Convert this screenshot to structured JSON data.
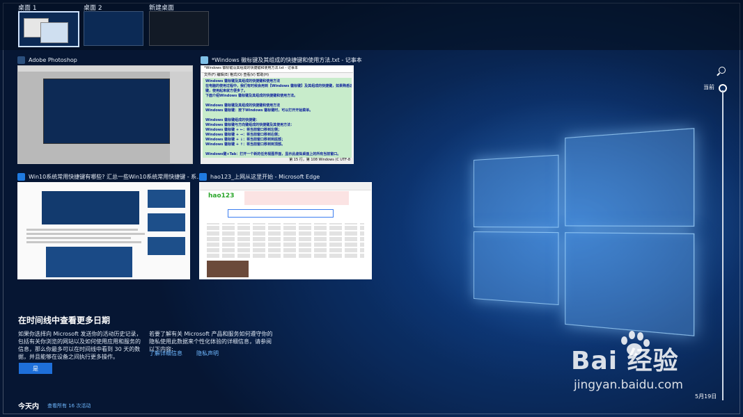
{
  "desktops": {
    "items": [
      {
        "label": "桌面 1"
      },
      {
        "label": "桌面 2"
      },
      {
        "label": "新建桌面"
      }
    ]
  },
  "windows": [
    {
      "title": "Adobe Photoshop",
      "icon": "photoshop-icon"
    },
    {
      "title": "*Windows 徽标键及其组成的快捷键和使用方法.txt - 记事本",
      "icon": "notepad-icon"
    },
    {
      "title": "Win10系统常用快捷键有哪些? 汇总一些Win10系统常用快捷键 - 系...",
      "icon": "edge-icon"
    },
    {
      "title": "hao123_上网从这里开始 - Microsoft Edge",
      "icon": "edge-icon"
    }
  ],
  "notepad": {
    "window_title": "*Windows 徽标键及其组成的快捷键和使用方法.txt - 记事本",
    "menu": "文件(F)  编辑(E)  格式(O)  查看(V)  帮助(H)",
    "lines": [
      "Windows 徽标键及其组成的快捷键和使用方法",
      "在电脑的使用过程中，我们有时候会用到【Windows 徽标键】及其组成的快捷键，如果熟悉这些快捷",
      "键，使用起来就方便多了。",
      "下面介绍Windows 徽标键及其组成的快捷键和使用方法。",
      "",
      "Windows 徽标键及其组成的快捷键和使用方法",
      "Windows 徽标键：按下Windows 徽标键时，可以打开开始菜单。",
      "",
      "Windows 徽标键组成的快捷键：",
      "Windows 徽标键与方向键组成的快捷键及其使用方法：",
      "Windows 徽标键 + ←：将当前窗口移到左侧；",
      "Windows 徽标键 + →：将当前窗口移到右侧；",
      "Windows 徽标键 + ↓：将当前窗口移到到底部；",
      "Windows 徽标键 + ↑：将当前窗口移到到顶部。",
      "",
      "Windows键+Tab：打开一个新的任务视图界面，显示此虚拟桌面上的所有当前窗口。"
    ],
    "status": "第 15 行，第 108  Windows (C  UTF-8"
  },
  "timeline": {
    "now_label": "当前",
    "date_label": "5月19日"
  },
  "info": {
    "title": "在时间线中查看更多日期",
    "paragraph1": "如果你选择向 Microsoft 发送你的活动历史记录，包括有关你浏览的网站以及如何使用应用和服务的信息，那么你最多可以在时间线中看到 30 天的数据，并且能够在设备之间执行更多操作。",
    "paragraph2": "若要了解有关 Microsoft 产品和服务如何遵守你的隐私使用此数据来个性化体验的详细信息，请参阅以下内容:",
    "learn_more": "了解详细信息",
    "privacy": "隐私声明",
    "yes_button": "是"
  },
  "today": {
    "label": "今天内",
    "view_all": "查看所有 16 次活动"
  },
  "watermark": {
    "brand": "Bai 经验",
    "url": "jingyan.baidu.com"
  }
}
